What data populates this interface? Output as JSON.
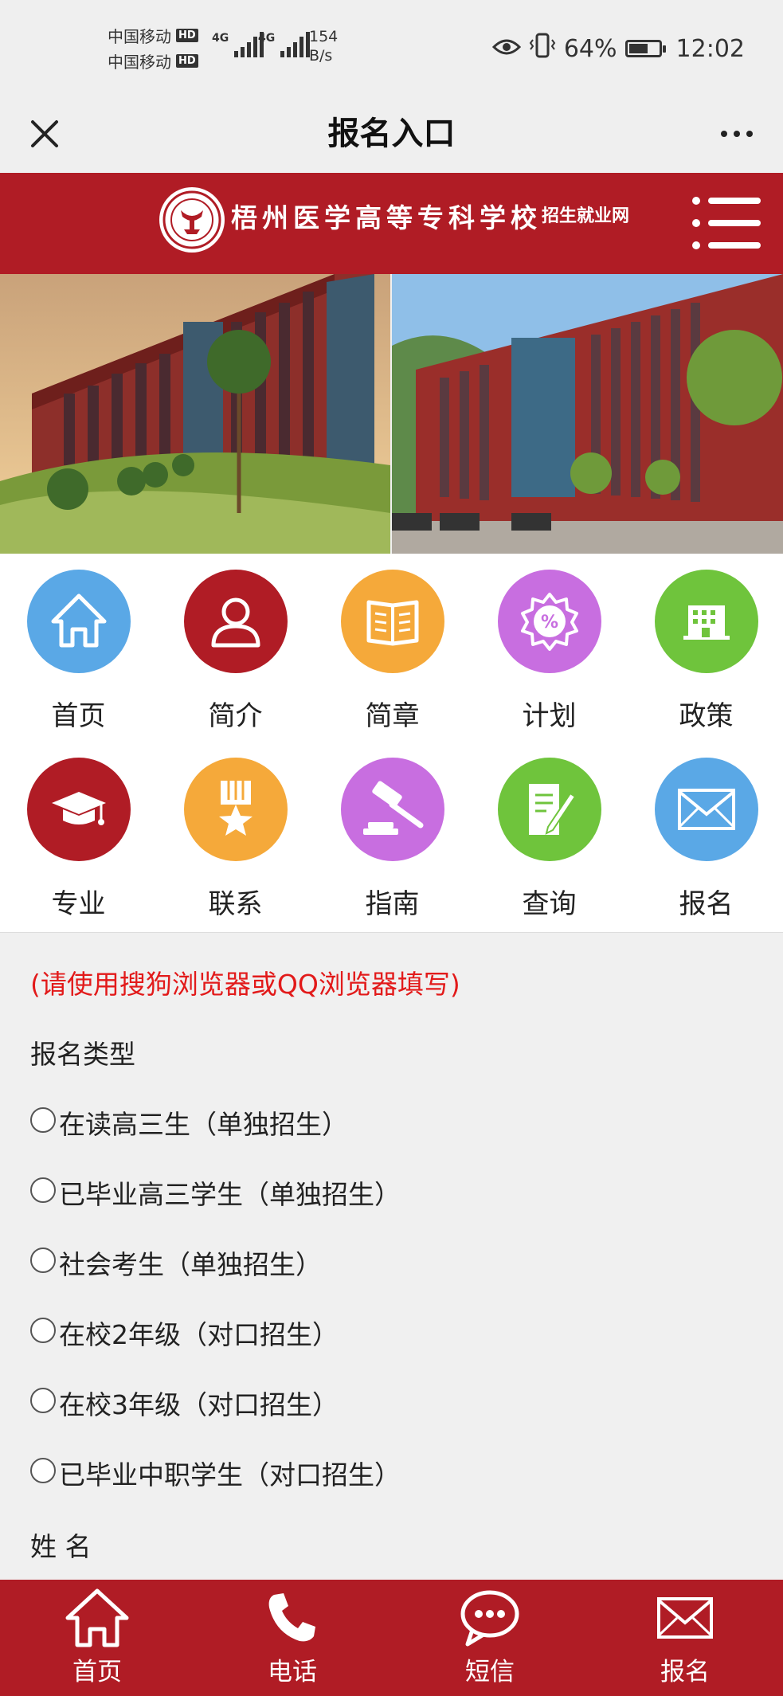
{
  "status_bar": {
    "carrier1": "中国移动",
    "carrier2": "中国移动",
    "hd": "HD",
    "net1": "4G",
    "net2": "4G",
    "speed_value": "154",
    "speed_unit": "B/s",
    "battery": "64%",
    "battery_level": 0.64,
    "time": "12:02"
  },
  "titlebar": {
    "title": "报名入口",
    "close_icon": "close-icon",
    "more_icon": "more-icon"
  },
  "site_header": {
    "school_name": "梧州医学高等专科学校",
    "subtitle": "招生就业网",
    "menu_icon": "menu-icon",
    "brand_color": "#b01c25"
  },
  "nav_grid": [
    {
      "label": "首页",
      "icon": "home-icon",
      "color": "#5aa8e6"
    },
    {
      "label": "简介",
      "icon": "user-icon",
      "color": "#b01c25"
    },
    {
      "label": "简章",
      "icon": "book-icon",
      "color": "#f5a93a"
    },
    {
      "label": "计划",
      "icon": "percent-badge-icon",
      "color": "#c86ee0"
    },
    {
      "label": "政策",
      "icon": "building-icon",
      "color": "#6fc43c"
    },
    {
      "label": "专业",
      "icon": "graduation-cap-icon",
      "color": "#b01c25"
    },
    {
      "label": "联系",
      "icon": "medal-icon",
      "color": "#f5a93a"
    },
    {
      "label": "指南",
      "icon": "gavel-icon",
      "color": "#c86ee0"
    },
    {
      "label": "查询",
      "icon": "document-edit-icon",
      "color": "#6fc43c"
    },
    {
      "label": "报名",
      "icon": "envelope-icon",
      "color": "#5aa8e6"
    }
  ],
  "form": {
    "notice": "(请使用搜狗浏览器或QQ浏览器填写)",
    "type_label": "报名类型",
    "options": [
      "在读高三生（单独招生）",
      "已毕业高三学生（单独招生）",
      "社会考生（单独招生）",
      "在校2年级（对口招生）",
      "在校3年级（对口招生）",
      "已毕业中职学生（对口招生）"
    ],
    "name_label": "姓 名"
  },
  "bottom_bar": [
    {
      "label": "首页",
      "icon": "home-outline-icon"
    },
    {
      "label": "电话",
      "icon": "phone-icon"
    },
    {
      "label": "短信",
      "icon": "chat-bubble-icon"
    },
    {
      "label": "报名",
      "icon": "envelope-icon"
    }
  ]
}
